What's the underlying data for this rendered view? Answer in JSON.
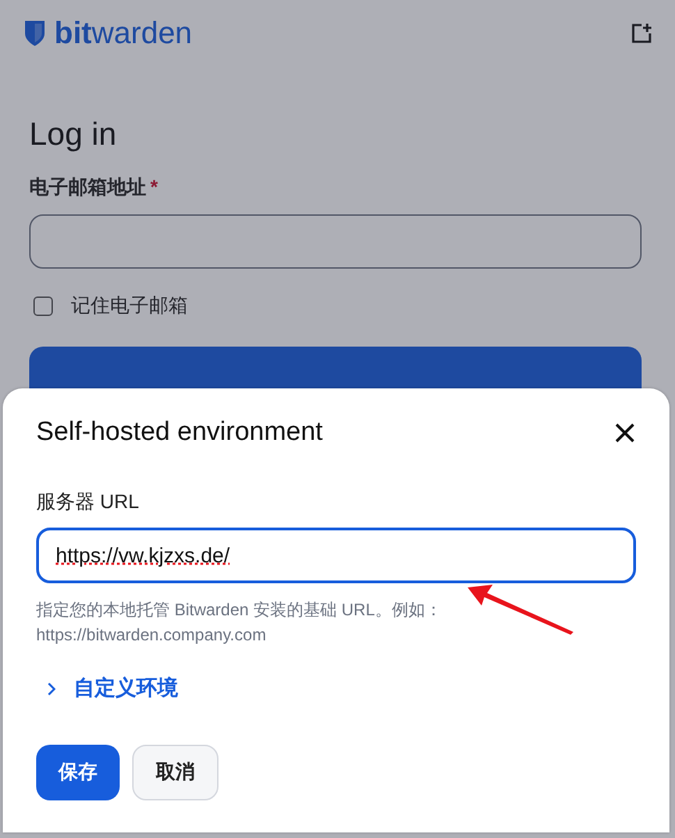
{
  "header": {
    "logo": "**bit**warden"
  },
  "login": {
    "title": "Log in",
    "email_label": "电子邮箱地址",
    "required_mark": "*",
    "remember": {
      "label": "记住电子邮箱",
      "checked": false
    }
  },
  "dialog": {
    "title": "Self-hosted environment",
    "server_url": {
      "label": "服务器 URL",
      "value": "https://vw.kjzxs.de/"
    },
    "hint": "指定您的本地托管 Bitwarden 安装的基础 URL。例如：https://bitwarden.company.com",
    "custom_env": {
      "label": "自定义环境",
      "expanded": false
    },
    "buttons": [
      {
        "label": "保存",
        "kind": "primary"
      },
      {
        "label": "取消",
        "kind": "secondary"
      }
    ]
  }
}
